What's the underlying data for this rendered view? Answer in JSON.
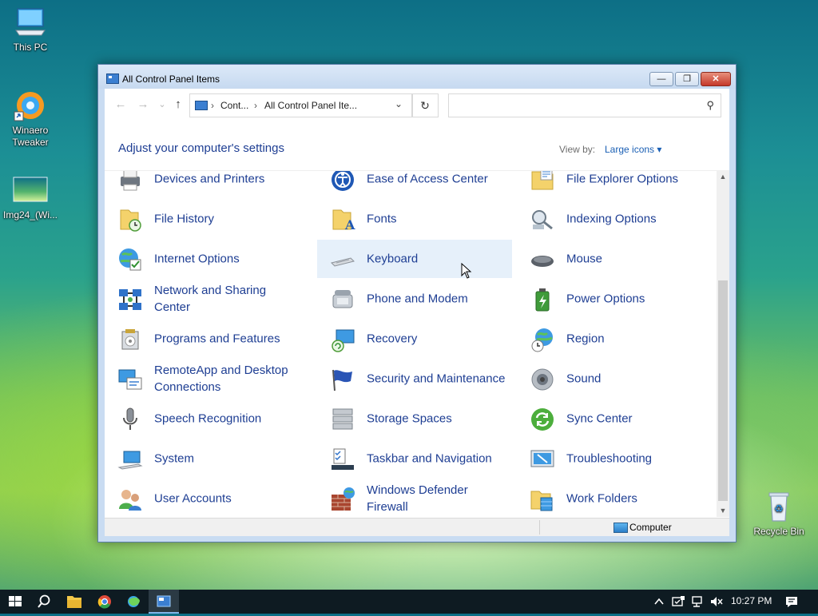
{
  "desktop": {
    "icons": [
      {
        "label": "This PC"
      },
      {
        "label": "Winaero Tweaker"
      },
      {
        "label": "Img24_(Wi..."
      },
      {
        "label": "Recycle Bin"
      }
    ]
  },
  "window": {
    "title": "All Control Panel Items",
    "min_glyph": "—",
    "max_glyph": "❐",
    "close_glyph": "✕",
    "nav": {
      "back_glyph": "←",
      "forward_glyph": "→",
      "recent_glyph": "⌄",
      "up_glyph": "↑",
      "crumb_sep": "›",
      "crumbs": [
        "Cont...",
        "All Control Panel Ite..."
      ],
      "dropdown_glyph": "⌄",
      "refresh_glyph": "↻",
      "search_placeholder": "",
      "search_glyph": "⚲"
    },
    "heading": "Adjust your computer's settings",
    "view_by_label": "View by:",
    "view_by_value": "Large icons ▾",
    "items": [
      {
        "label": "Devices and Printers",
        "icon": "printer-icon"
      },
      {
        "label": "Ease of Access Center",
        "icon": "ease-of-access-icon"
      },
      {
        "label": "File Explorer Options",
        "icon": "folder-options-icon"
      },
      {
        "label": "File History",
        "icon": "file-history-icon"
      },
      {
        "label": "Fonts",
        "icon": "fonts-folder-icon"
      },
      {
        "label": "Indexing Options",
        "icon": "indexing-icon"
      },
      {
        "label": "Internet Options",
        "icon": "globe-check-icon"
      },
      {
        "label": "Keyboard",
        "icon": "keyboard-icon"
      },
      {
        "label": "Mouse",
        "icon": "mouse-icon"
      },
      {
        "label": "Network and Sharing Center",
        "icon": "network-icon"
      },
      {
        "label": "Phone and Modem",
        "icon": "phone-icon"
      },
      {
        "label": "Power Options",
        "icon": "battery-icon"
      },
      {
        "label": "Programs and Features",
        "icon": "programs-icon"
      },
      {
        "label": "Recovery",
        "icon": "recovery-icon"
      },
      {
        "label": "Region",
        "icon": "region-globe-icon"
      },
      {
        "label": "RemoteApp and Desktop Connections",
        "icon": "remoteapp-icon"
      },
      {
        "label": "Security and Maintenance",
        "icon": "flag-icon"
      },
      {
        "label": "Sound",
        "icon": "speaker-icon"
      },
      {
        "label": "Speech Recognition",
        "icon": "microphone-icon"
      },
      {
        "label": "Storage Spaces",
        "icon": "storage-icon"
      },
      {
        "label": "Sync Center",
        "icon": "sync-icon"
      },
      {
        "label": "System",
        "icon": "system-laptop-icon"
      },
      {
        "label": "Taskbar and Navigation",
        "icon": "taskbar-icon"
      },
      {
        "label": "Troubleshooting",
        "icon": "troubleshooting-icon"
      },
      {
        "label": "User Accounts",
        "icon": "users-icon"
      },
      {
        "label": "Windows Defender Firewall",
        "icon": "firewall-icon"
      },
      {
        "label": "Work Folders",
        "icon": "work-folders-icon"
      }
    ],
    "status": {
      "location": "Computer"
    }
  },
  "taskbar": {
    "clock": "10:27 PM",
    "tray_chevron": "^",
    "pinned": [
      "start",
      "search",
      "file-explorer",
      "chrome",
      "edge",
      "control-panel"
    ]
  },
  "colors": {
    "link_blue": "#1e3e93",
    "accent": "#1a5fb4",
    "hover_bg": "#e6f0fa"
  }
}
